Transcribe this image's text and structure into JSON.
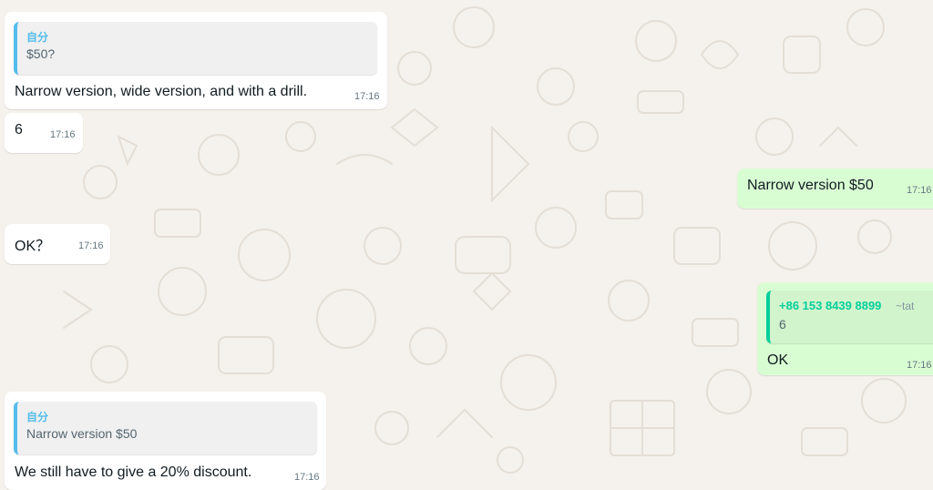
{
  "colors": {
    "incoming_bg": "#ffffff",
    "outgoing_bg": "#d9fdd3",
    "wallpaper_bg": "#f5f1ec",
    "quote_accent_blue": "#53bdeb",
    "quote_accent_green": "#06cf9c"
  },
  "messages": [
    {
      "direction": "incoming",
      "quote": {
        "author": "自分",
        "text": "$50?"
      },
      "text": "Narrow version, wide version, and with a drill.",
      "time": "17:16"
    },
    {
      "direction": "incoming",
      "text": "6",
      "time": "17:16"
    },
    {
      "direction": "outgoing",
      "text": "Narrow version $50",
      "time": "17:16"
    },
    {
      "direction": "incoming",
      "text": "OK？",
      "time": "17:16"
    },
    {
      "direction": "outgoing",
      "quote": {
        "author": "+86 153 8439 8899",
        "alias": "~tat",
        "text": "6"
      },
      "text": "OK",
      "time": "17:16"
    },
    {
      "direction": "incoming",
      "quote": {
        "author": "自分",
        "text": "Narrow version $50"
      },
      "text": "We still have to give a 20% discount.",
      "time": "17:16"
    }
  ]
}
